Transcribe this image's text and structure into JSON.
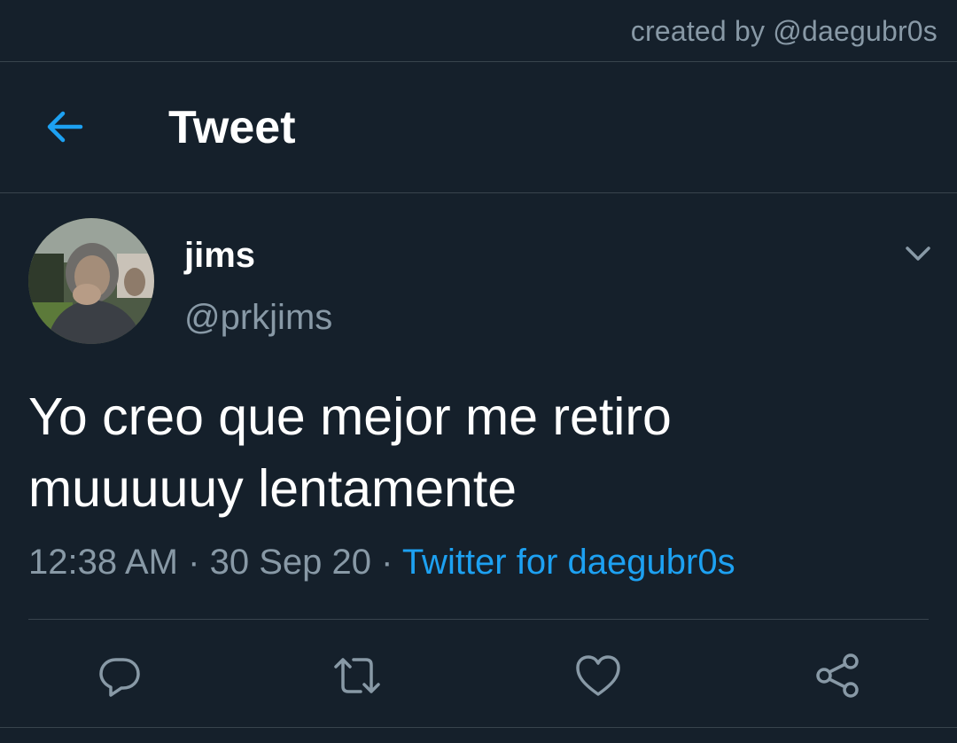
{
  "watermark": {
    "credit": "created by @daegubr0s"
  },
  "header": {
    "title": "Tweet",
    "back_icon": "arrow-left-icon"
  },
  "tweet": {
    "display_name": "jims",
    "handle": "@prkjims",
    "text_line1": "Yo creo que mejor me retiro",
    "text_line2": "muuuuuy lentamente",
    "time": "12:38 AM",
    "date": "30 Sep 20",
    "separator": "·",
    "source": "Twitter for daegubr0s"
  },
  "actions": [
    "reply-icon",
    "retweet-icon",
    "like-icon",
    "share-icon"
  ],
  "colors": {
    "background": "#15202b",
    "border": "#38444d",
    "secondary_text": "#8899a6",
    "accent": "#1da1f2",
    "primary_text": "#ffffff"
  }
}
